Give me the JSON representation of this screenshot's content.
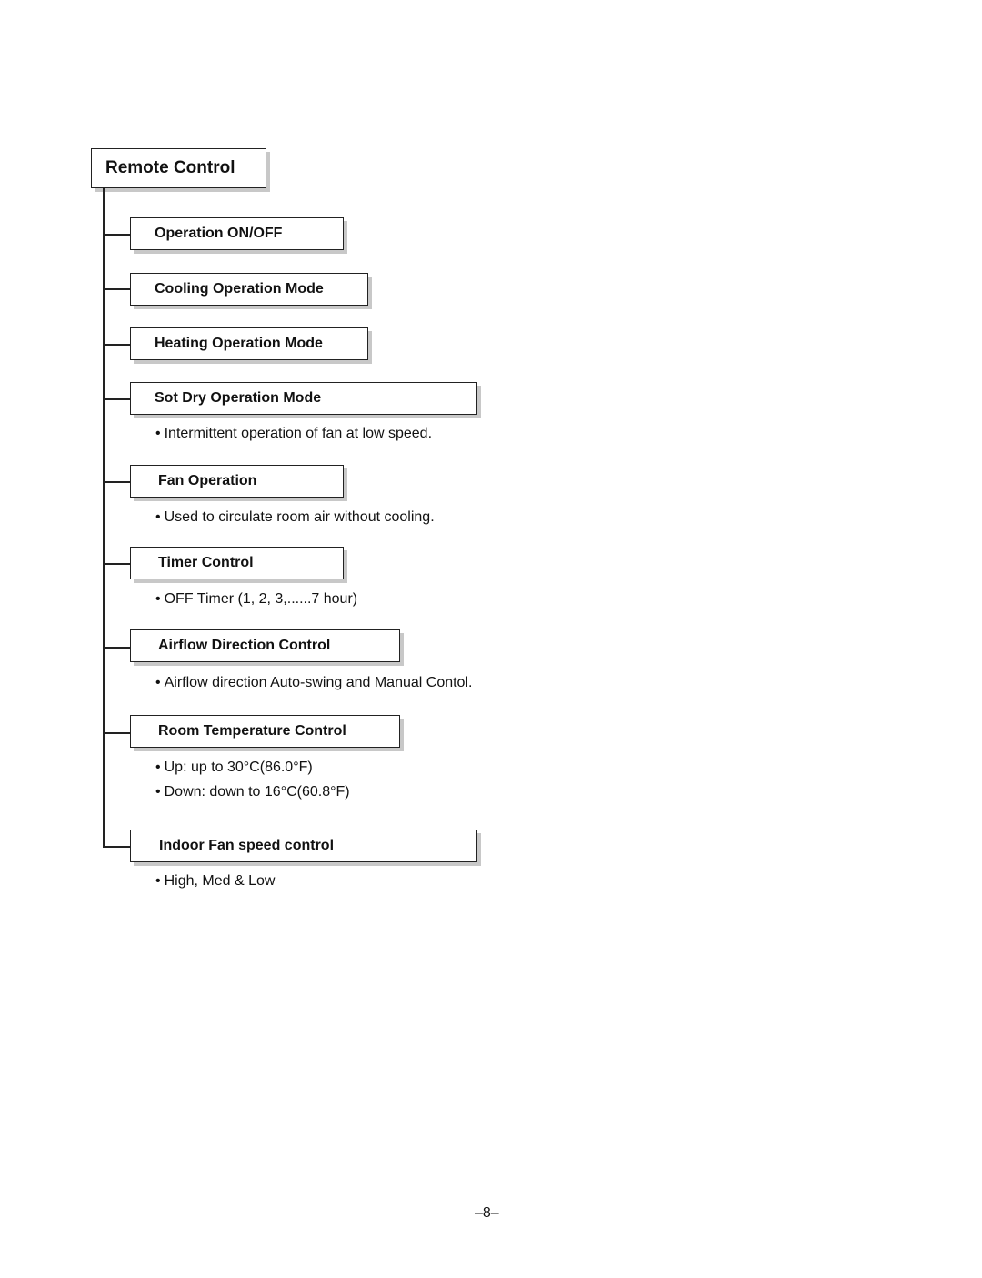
{
  "title": "Remote Control",
  "items": [
    {
      "label": "Operation ON/OFF",
      "notes": []
    },
    {
      "label": "Cooling Operation Mode",
      "notes": []
    },
    {
      "label": "Heating Operation Mode",
      "notes": []
    },
    {
      "label": "Sot Dry Operation Mode",
      "notes": [
        "Intermittent operation of fan at low speed."
      ]
    },
    {
      "label": "Fan Operation",
      "notes": [
        "Used to circulate room air without cooling."
      ]
    },
    {
      "label": "Timer Control",
      "notes": [
        "OFF Timer (1, 2, 3,......7 hour)"
      ]
    },
    {
      "label": "Airflow Direction Control",
      "notes": [
        "Airflow direction Auto-swing and Manual Contol."
      ]
    },
    {
      "label": "Room Temperature Control",
      "notes": [
        "Up: up to 30°C(86.0°F)",
        "Down: down to 16°C(60.8°F)"
      ]
    },
    {
      "label": "Indoor Fan speed control",
      "notes": [
        "High, Med & Low"
      ]
    }
  ],
  "bullet_char": "•",
  "page_number": "–8–"
}
